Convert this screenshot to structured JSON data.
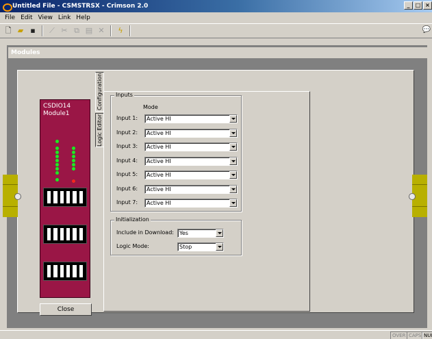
{
  "window": {
    "title": "Untitled File - CSMSTRSX - Crimson 2.0"
  },
  "menu": [
    "File",
    "Edit",
    "View",
    "Link",
    "Help"
  ],
  "toolbar": {
    "icons": [
      "new-icon",
      "open-icon",
      "save-icon",
      "wand-icon",
      "cut-icon",
      "copy-icon",
      "paste-icon",
      "delete-icon",
      "lightning-icon",
      "help-icon"
    ]
  },
  "modules_window": {
    "title": "Modules"
  },
  "module": {
    "model": "CSDIO14",
    "name": "Module1",
    "close_label": "Close"
  },
  "tabs": {
    "configuration": "Configuration",
    "logic_editor": "Logic Editor"
  },
  "inputs": {
    "group_label": "Inputs",
    "mode_header": "Mode",
    "rows": [
      {
        "label": "Input 1:",
        "value": "Active HI"
      },
      {
        "label": "Input 2:",
        "value": "Active HI"
      },
      {
        "label": "Input 3:",
        "value": "Active HI"
      },
      {
        "label": "Input 4:",
        "value": "Active HI"
      },
      {
        "label": "Input 5:",
        "value": "Active HI"
      },
      {
        "label": "Input 6:",
        "value": "Active HI"
      },
      {
        "label": "Input 7:",
        "value": "Active HI"
      }
    ]
  },
  "initialization": {
    "group_label": "Initialization",
    "include_label": "Include in Download:",
    "include_value": "Yes",
    "logic_label": "Logic Mode:",
    "logic_value": "Stop"
  },
  "statusbar": {
    "over": "OVER",
    "caps": "CAPS",
    "num": "NUI"
  }
}
